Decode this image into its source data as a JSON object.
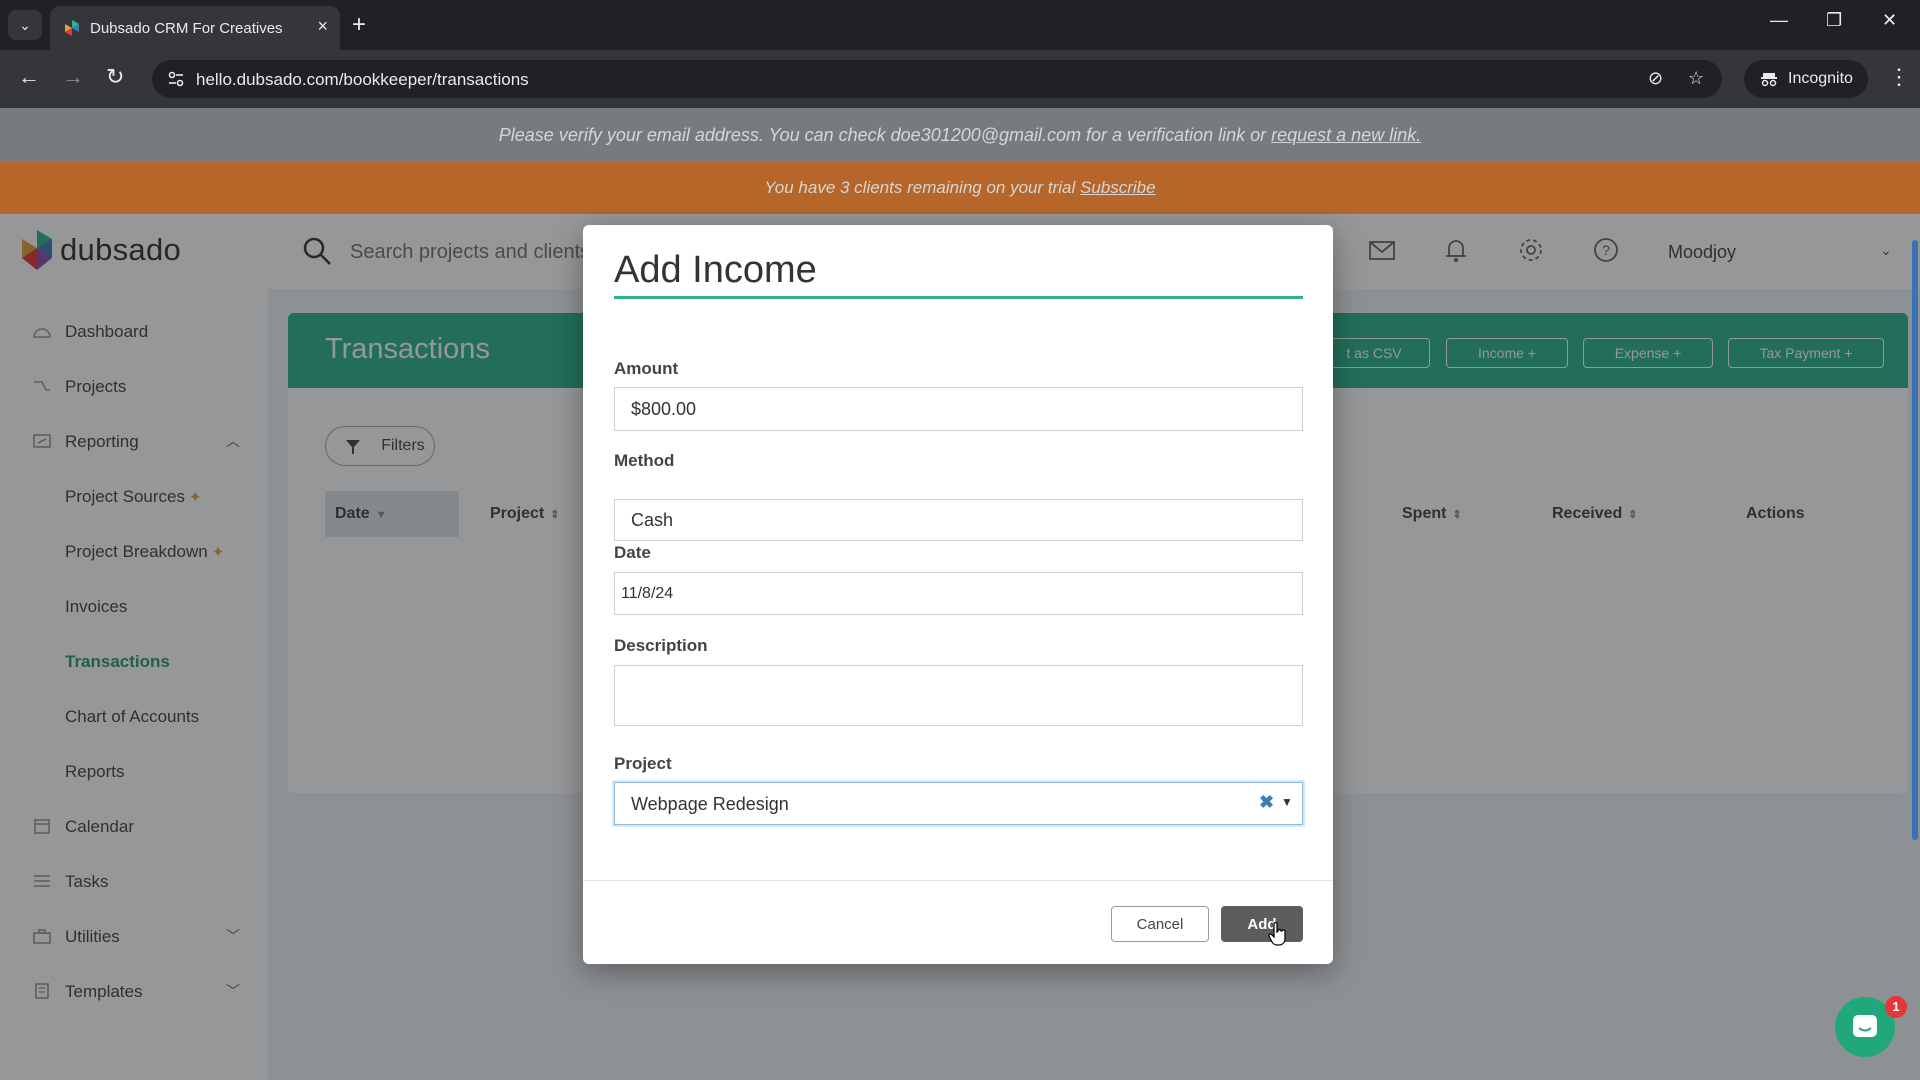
{
  "browser": {
    "tab_title": "Dubsado CRM For Creatives",
    "url": "hello.dubsado.com/bookkeeper/transactions",
    "incognito_label": "Incognito"
  },
  "banners": {
    "verify_text": "Please verify your email address. You can check doe301200@gmail.com for a verification link or ",
    "verify_link": "request a new link.",
    "trial_text": "You have 3 clients remaining on your trial ",
    "trial_link": "Subscribe"
  },
  "header": {
    "logo_text": "dubsado",
    "search_placeholder": "Search projects and clients",
    "user_name": "Moodjoy"
  },
  "sidebar": {
    "items": [
      {
        "label": "Dashboard"
      },
      {
        "label": "Projects"
      },
      {
        "label": "Reporting"
      },
      {
        "label": "Project Sources"
      },
      {
        "label": "Project Breakdown"
      },
      {
        "label": "Invoices"
      },
      {
        "label": "Transactions"
      },
      {
        "label": "Chart of Accounts"
      },
      {
        "label": "Reports"
      },
      {
        "label": "Calendar"
      },
      {
        "label": "Tasks"
      },
      {
        "label": "Utilities"
      },
      {
        "label": "Templates"
      }
    ]
  },
  "main": {
    "title": "Transactions",
    "buttons": {
      "export_csv": "t as CSV",
      "income": "Income +",
      "expense": "Expense +",
      "tax_payment": "Tax Payment +"
    },
    "filters_label": "Filters",
    "columns": {
      "date": "Date",
      "project": "Project",
      "spent": "Spent",
      "received": "Received",
      "actions": "Actions"
    }
  },
  "modal": {
    "title": "Add Income",
    "amount_label": "Amount",
    "amount_value": "$800.00",
    "method_label": "Method",
    "method_value": "Cash",
    "date_label": "Date",
    "date_value": "11/8/24",
    "description_label": "Description",
    "description_value": "",
    "project_label": "Project",
    "project_value": "Webpage Redesign",
    "cancel_label": "Cancel",
    "add_label": "Add"
  },
  "chat": {
    "badge_count": "1"
  },
  "colors": {
    "brand_green": "#2fb48a",
    "trial_orange": "#d9782c",
    "verify_gray": "#8b9296"
  }
}
